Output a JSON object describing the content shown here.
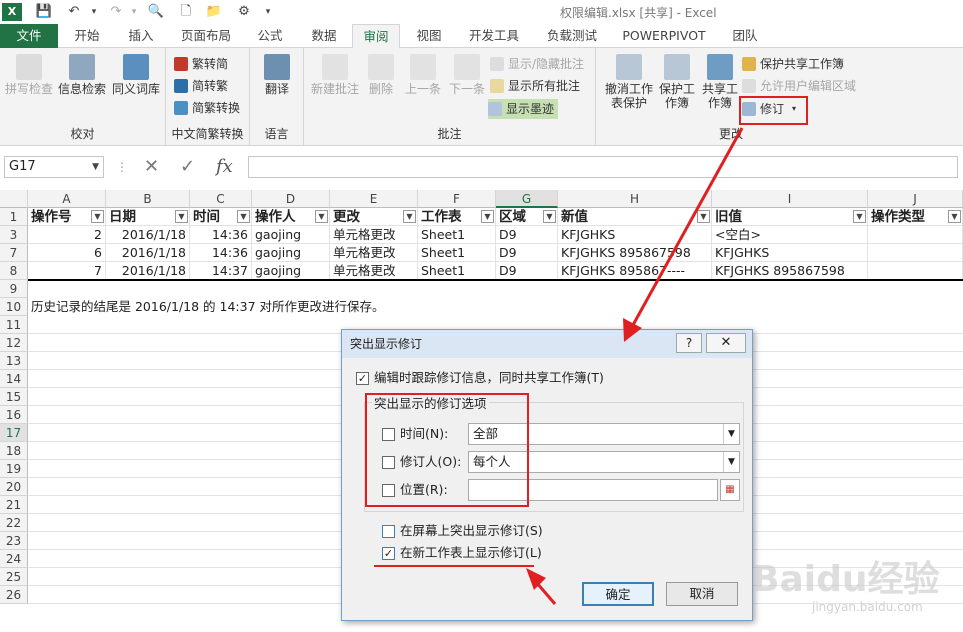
{
  "window": {
    "title": "权限编辑.xlsx  [共享] - Excel"
  },
  "qat": {
    "icons": [
      "excel-logo-icon",
      "save-icon",
      "undo-icon",
      "redo-icon",
      "print-preview-icon",
      "new-file-icon",
      "open-folder-icon",
      "touch-mode-icon",
      "customize-qat-icon"
    ]
  },
  "tabs": [
    "文件",
    "开始",
    "插入",
    "页面布局",
    "公式",
    "数据",
    "审阅",
    "视图",
    "开发工具",
    "负载测试",
    "POWERPIVOT",
    "团队"
  ],
  "active_tab": "审阅",
  "ribbon": {
    "proofing": {
      "name": "校对",
      "spell": "拼写检查",
      "research": "信息检索",
      "thesaurus": "同义词库"
    },
    "chinese": {
      "name": "中文简繁转换",
      "t2s": "繁转简",
      "s2t": "简转繁",
      "convert": "简繁转换"
    },
    "language": {
      "name": "语言",
      "translate": "翻译"
    },
    "comments": {
      "name": "批注",
      "new": "新建批注",
      "delete": "删除",
      "prev": "上一条",
      "next": "下一条",
      "show_hide": "显示/隐藏批注",
      "show_all": "显示所有批注",
      "show_ink": "显示墨迹"
    },
    "changes": {
      "name": "更改",
      "unprotect_sheet": "撤消工作表保护",
      "protect_wb": "保护工作簿",
      "share_wb": "共享工作簿",
      "protect_share": "保护共享工作簿",
      "allow_edit": "允许用户编辑区域",
      "track": "修订"
    }
  },
  "formula_bar": {
    "name_box": "G17",
    "cancel_icon": "✕",
    "enter_icon": "✓",
    "fx": "fx",
    "value": ""
  },
  "columns": [
    "A",
    "B",
    "C",
    "D",
    "E",
    "F",
    "G",
    "H",
    "I",
    "J"
  ],
  "rows": [
    "1",
    "3",
    "7",
    "8",
    "9",
    "10",
    "11",
    "12",
    "13",
    "14",
    "15",
    "16",
    "17",
    "18",
    "19",
    "20",
    "21",
    "22",
    "23",
    "24",
    "25",
    "26"
  ],
  "headers": [
    "操作号",
    "日期",
    "时间",
    "操作人",
    "更改",
    "工作表",
    "区域",
    "新值",
    "旧值",
    "操作类型"
  ],
  "data_rows": [
    [
      "2",
      "2016/1/18",
      "14:36",
      "gaojing",
      "单元格更改",
      "Sheet1",
      "D9",
      "KFJGHKS",
      "<空白>",
      ""
    ],
    [
      "6",
      "2016/1/18",
      "14:36",
      "gaojing",
      "单元格更改",
      "Sheet1",
      "D9",
      "KFJGHKS 895867598",
      "KFJGHKS",
      ""
    ],
    [
      "7",
      "2016/1/18",
      "14:37",
      "gaojing",
      "单元格更改",
      "Sheet1",
      "D9",
      "KFJGHKS 895867----",
      "KFJGHKS 895867598",
      ""
    ]
  ],
  "history_note": "历史记录的结尾是 2016/1/18 的 14:37 对所作更改进行保存。",
  "dialog": {
    "title": "突出显示修订",
    "help": "?",
    "close": "✕",
    "track_label": "编辑时跟踪修订信息，同时共享工作簿(T)",
    "group_label": "突出显示的修订选项",
    "when_label": "时间(N):",
    "when_value": "全部",
    "who_label": "修订人(O):",
    "who_value": "每个人",
    "where_label": "位置(R):",
    "where_value": "",
    "onscreen_label": "在屏幕上突出显示修订(S)",
    "newsheet_label": "在新工作表上显示修订(L)",
    "ok": "确定",
    "cancel": "取消"
  },
  "watermark": {
    "main": "Baidu经验",
    "sub": "jingyan.baidu.com"
  },
  "colors": {
    "excel_green": "#217346",
    "annotation_red": "#e02020"
  }
}
